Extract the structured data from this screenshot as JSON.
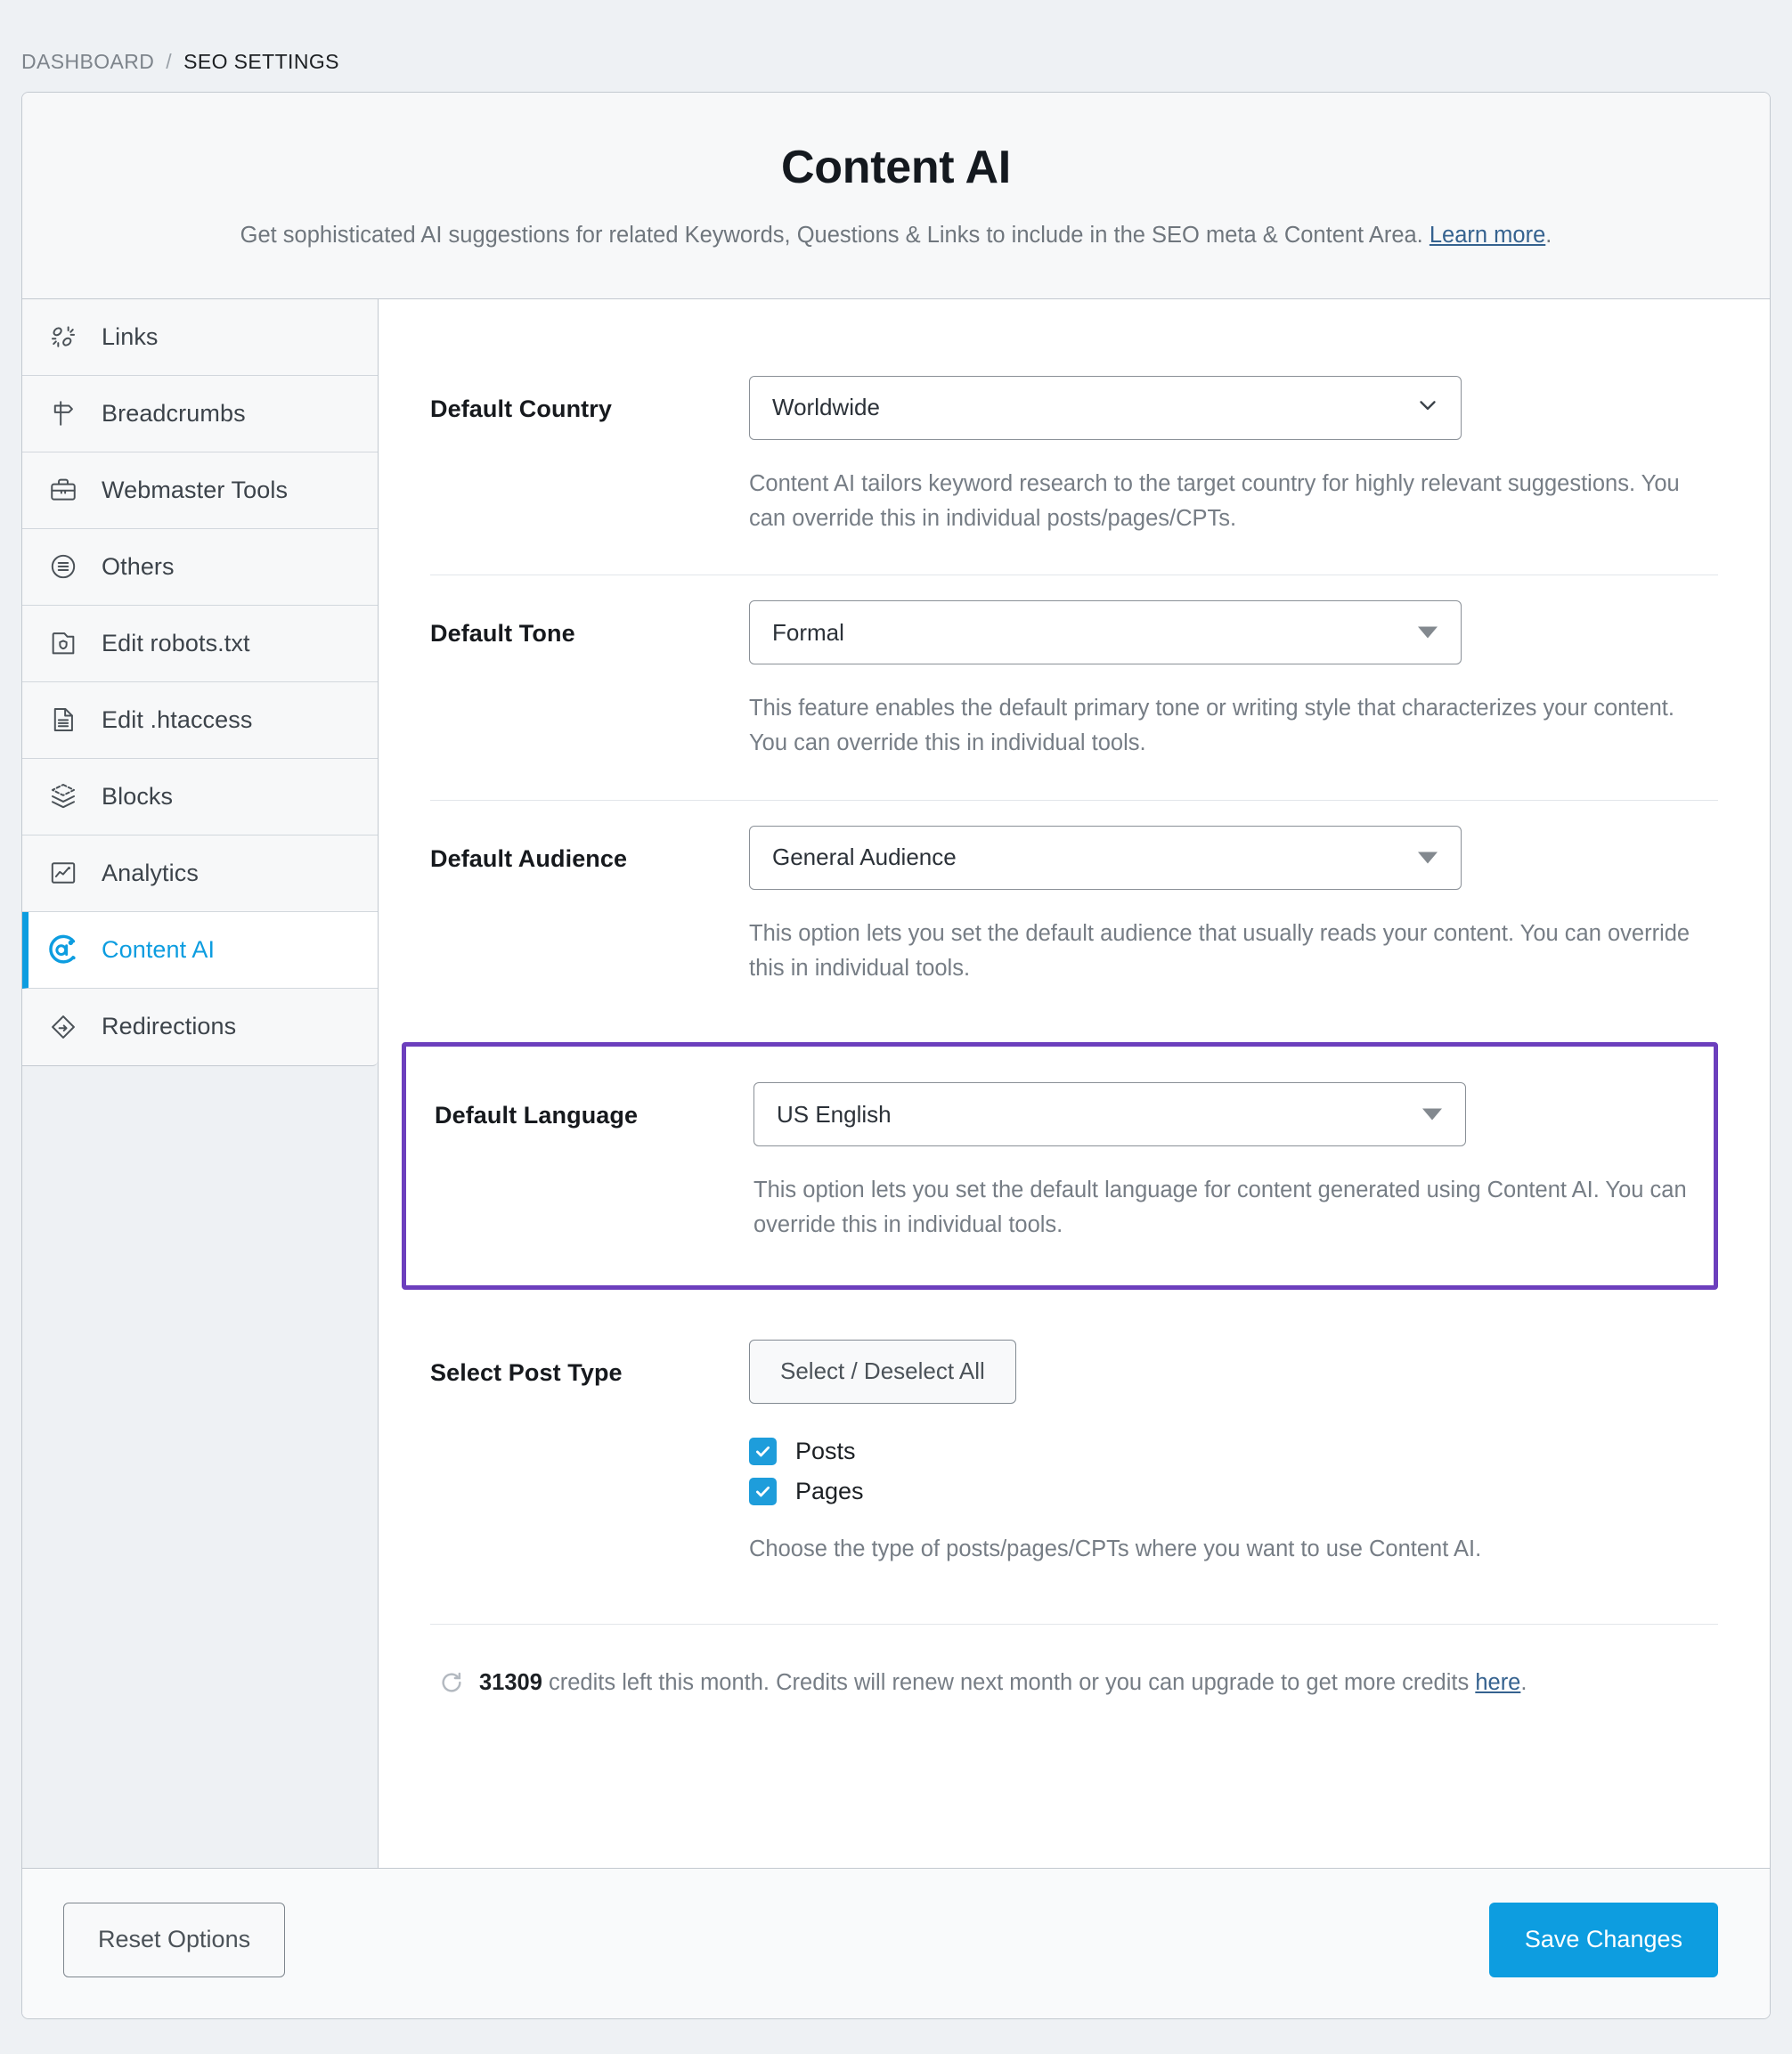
{
  "breadcrumb": {
    "root": "DASHBOARD",
    "separator": "/",
    "current": "SEO SETTINGS"
  },
  "header": {
    "title": "Content AI",
    "description_before": "Get sophisticated AI suggestions for related Keywords, Questions & Links to include in the SEO meta & Content Area.",
    "learn_more": "Learn more",
    "description_after": "."
  },
  "sidebar": {
    "items": [
      {
        "label": "Links",
        "icon": "links-icon",
        "active": false
      },
      {
        "label": "Breadcrumbs",
        "icon": "signpost-icon",
        "active": false
      },
      {
        "label": "Webmaster Tools",
        "icon": "briefcase-icon",
        "active": false
      },
      {
        "label": "Others",
        "icon": "circle-list-icon",
        "active": false
      },
      {
        "label": "Edit robots.txt",
        "icon": "robots-folder-icon",
        "active": false
      },
      {
        "label": "Edit .htaccess",
        "icon": "document-lines-icon",
        "active": false
      },
      {
        "label": "Blocks",
        "icon": "layers-icon",
        "active": false
      },
      {
        "label": "Analytics",
        "icon": "chart-square-icon",
        "active": false
      },
      {
        "label": "Content AI",
        "icon": "content-ai-icon",
        "active": true
      },
      {
        "label": "Redirections",
        "icon": "redirect-diamond-icon",
        "active": false
      }
    ]
  },
  "fields": {
    "country": {
      "label": "Default Country",
      "value": "Worldwide",
      "caret": "chevron-down-icon",
      "description": "Content AI tailors keyword research to the target country for highly relevant suggestions. You can override this in individual posts/pages/CPTs."
    },
    "tone": {
      "label": "Default Tone",
      "value": "Formal",
      "caret": "triangle-down-icon",
      "description": "This feature enables the default primary tone or writing style that characterizes your content. You can override this in individual tools."
    },
    "audience": {
      "label": "Default Audience",
      "value": "General Audience",
      "caret": "triangle-down-icon",
      "description": "This option lets you set the default audience that usually reads your content. You can override this in individual tools."
    },
    "language": {
      "label": "Default Language",
      "value": "US English",
      "caret": "triangle-down-icon",
      "description": "This option lets you set the default language for content generated using Content AI. You can override this in individual tools.",
      "highlight_color": "#6c3fbd"
    },
    "post_type": {
      "label": "Select Post Type",
      "toggle_all_label": "Select / Deselect All",
      "options": [
        {
          "label": "Posts",
          "checked": true
        },
        {
          "label": "Pages",
          "checked": true
        }
      ],
      "description": "Choose the type of posts/pages/CPTs where you want to use Content AI."
    }
  },
  "credits": {
    "icon": "refresh-icon",
    "amount": "31309",
    "text_before": " credits left this month. Credits will renew next month or you can upgrade to get more credits ",
    "link": "here",
    "text_after": "."
  },
  "footer": {
    "reset_label": "Reset Options",
    "save_label": "Save Changes"
  },
  "colors": {
    "accent_blue": "#0d9de0",
    "highlight_purple": "#6c3fbd",
    "page_bg": "#eef1f4",
    "link": "#35628f"
  }
}
